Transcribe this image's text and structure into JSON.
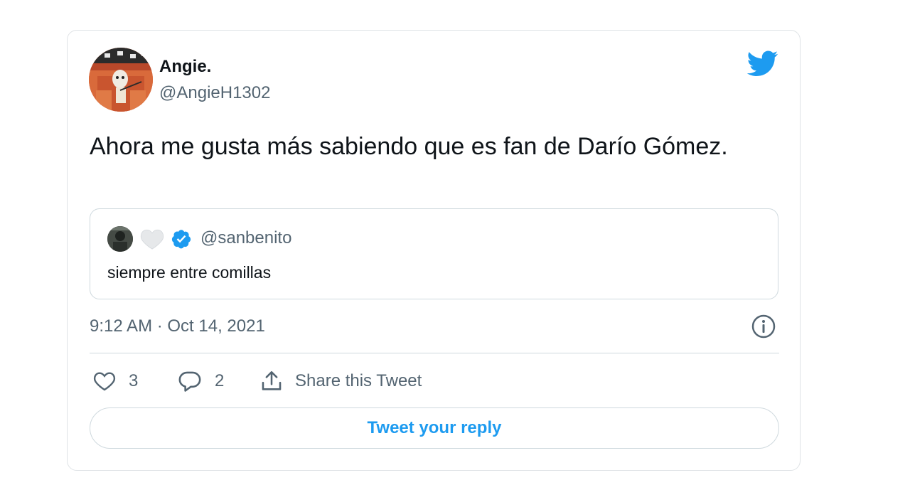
{
  "tweet": {
    "author": {
      "display_name": "Angie.",
      "handle": "@AngieH1302",
      "avatar_icon": "avatar-image"
    },
    "text": "Ahora me gusta más sabiendo que es fan de Darío Gómez.",
    "quoted_tweet": {
      "name_icons": [
        "avatar-image",
        "white-heart-icon",
        "verified-badge-icon"
      ],
      "handle": "@sanbenito",
      "text": "siempre entre comillas"
    },
    "timestamp": "9:12 AM · Oct 14, 2021",
    "actions": {
      "like_count": "3",
      "reply_count": "2",
      "share_label": "Share this Tweet"
    },
    "reply_button_label": "Tweet your reply"
  },
  "colors": {
    "brand_blue": "#1d9bf0",
    "text_primary": "#0f1419",
    "text_secondary": "#536471",
    "border": "#cfd9de"
  },
  "icons": {
    "logo": "twitter-bird-icon",
    "info": "info-icon",
    "like": "heart-outline-icon",
    "reply": "speech-bubble-icon",
    "share": "share-upload-icon"
  }
}
